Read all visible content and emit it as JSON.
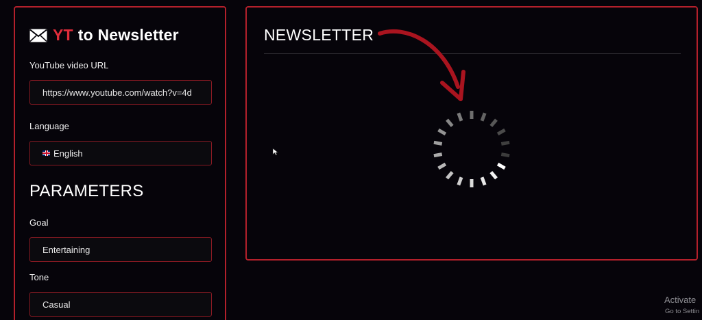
{
  "app": {
    "brand_accent": "YT",
    "brand_rest": "to Newsletter",
    "icon": "envelope-icon",
    "accent_color": "#e02d3b",
    "border_color": "#b3202b"
  },
  "form": {
    "url_label": "YouTube video URL",
    "url_value": "https://www.youtube.com/watch?v=4d",
    "language_label": "Language",
    "language_value": "English",
    "language_flag": "uk-flag-icon",
    "parameters_heading": "PARAMETERS",
    "goal_label": "Goal",
    "goal_value": "Entertaining",
    "tone_label": "Tone",
    "tone_value": "Casual"
  },
  "output": {
    "title": "NEWSLETTER",
    "status": "loading",
    "indicator": "spinner-icon",
    "annotation": "curved-arrow-icon"
  },
  "watermark": {
    "line1": "Activate",
    "line2": "Go to Settin"
  }
}
